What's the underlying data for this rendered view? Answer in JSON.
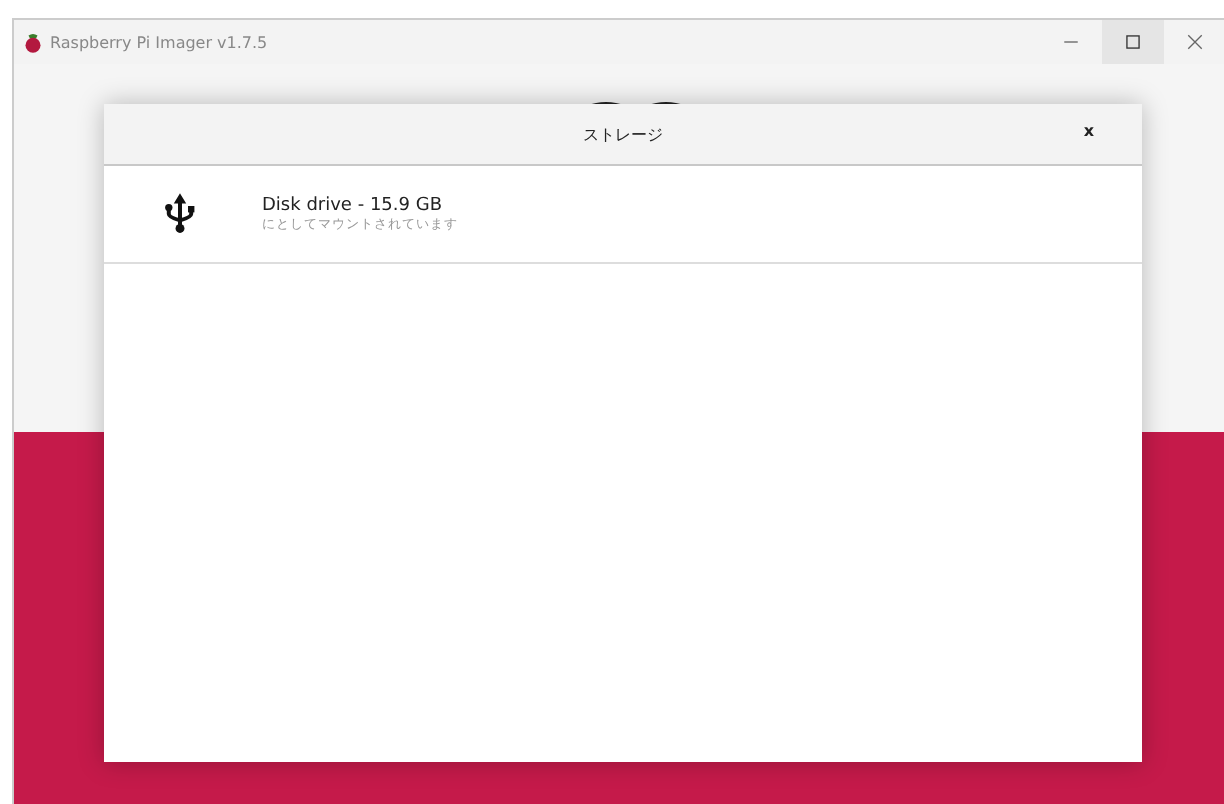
{
  "window": {
    "title": "Raspberry Pi Imager v1.7.5"
  },
  "dialog": {
    "title": "ストレージ",
    "close": "x",
    "items": [
      {
        "name": "Disk drive - 15.9 GB",
        "detail": "にとしてマウントされています",
        "kind": "usb"
      }
    ]
  }
}
